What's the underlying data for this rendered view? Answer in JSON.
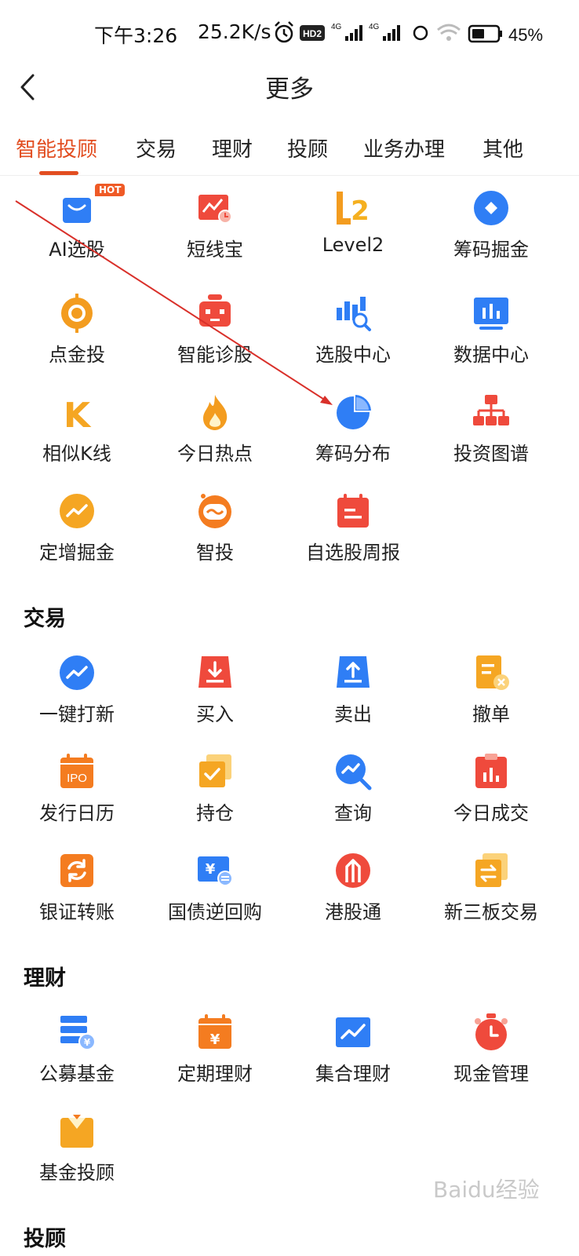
{
  "status_bar": {
    "time": "下午3:26",
    "net_speed": "25.2K/s",
    "hd_badge": "HD2",
    "signal_label_1": "4G",
    "signal_label_2": "4G",
    "battery": "45%",
    "icons": [
      "alarm-icon",
      "hd-icon",
      "signal-icon",
      "signal-icon",
      "link-icon",
      "wifi-icon",
      "battery-icon"
    ]
  },
  "header": {
    "title": "更多",
    "back_icon": "chevron-left-icon"
  },
  "tabs": [
    {
      "label": "智能投顾",
      "active": true
    },
    {
      "label": "交易"
    },
    {
      "label": "理财"
    },
    {
      "label": "投顾"
    },
    {
      "label": "业务办理"
    },
    {
      "label": "其他"
    }
  ],
  "colors": {
    "accent": "#e24d20",
    "blue": "#2f7ef5",
    "orange": "#f39c1f",
    "red": "#ef4a3c"
  },
  "sections": {
    "zhineng": {
      "items": [
        {
          "label": "AI选股",
          "icon": "shopping-bag-icon",
          "badge": "HOT"
        },
        {
          "label": "短线宝",
          "icon": "trend-clock-icon"
        },
        {
          "label": "Level2",
          "icon": "l2-icon"
        },
        {
          "label": "筹码掘金",
          "icon": "diamond-icon"
        },
        {
          "label": "点金投",
          "icon": "target-icon"
        },
        {
          "label": "智能诊股",
          "icon": "robot-icon"
        },
        {
          "label": "选股中心",
          "icon": "candlestick-search-icon"
        },
        {
          "label": "数据中心",
          "icon": "bar-chart-icon"
        },
        {
          "label": "相似K线",
          "icon": "k-letter-icon"
        },
        {
          "label": "今日热点",
          "icon": "flame-icon"
        },
        {
          "label": "筹码分布",
          "icon": "pie-chart-icon"
        },
        {
          "label": "投资图谱",
          "icon": "org-chart-icon"
        },
        {
          "label": "定增掘金",
          "icon": "trend-circle-icon"
        },
        {
          "label": "智投",
          "icon": "robot-face-icon"
        },
        {
          "label": "自选股周报",
          "icon": "calendar-report-icon"
        }
      ]
    },
    "jiaoyi": {
      "title": "交易",
      "items": [
        {
          "label": "一键打新",
          "icon": "trend-circle-icon"
        },
        {
          "label": "买入",
          "icon": "download-tray-icon"
        },
        {
          "label": "卖出",
          "icon": "upload-tray-icon"
        },
        {
          "label": "撤单",
          "icon": "document-cancel-icon"
        },
        {
          "label": "发行日历",
          "icon": "ipo-calendar-icon",
          "icon_text": "IPO"
        },
        {
          "label": "持仓",
          "icon": "checkbox-stack-icon"
        },
        {
          "label": "查询",
          "icon": "search-trend-icon"
        },
        {
          "label": "今日成交",
          "icon": "clipboard-chart-icon"
        },
        {
          "label": "银证转账",
          "icon": "transfer-icon"
        },
        {
          "label": "国债逆回购",
          "icon": "bond-repurchase-icon"
        },
        {
          "label": "港股通",
          "icon": "hk-connect-icon"
        },
        {
          "label": "新三板交易",
          "icon": "exchange-doc-icon"
        }
      ]
    },
    "licai": {
      "title": "理财",
      "items": [
        {
          "label": "公募基金",
          "icon": "fund-stack-icon"
        },
        {
          "label": "定期理财",
          "icon": "yuan-calendar-icon"
        },
        {
          "label": "集合理财",
          "icon": "trend-board-icon"
        },
        {
          "label": "现金管理",
          "icon": "stopwatch-icon"
        },
        {
          "label": "基金投顾",
          "icon": "suit-icon"
        }
      ]
    },
    "tougu": {
      "title": "投顾"
    }
  },
  "watermark": "Baidu经验"
}
